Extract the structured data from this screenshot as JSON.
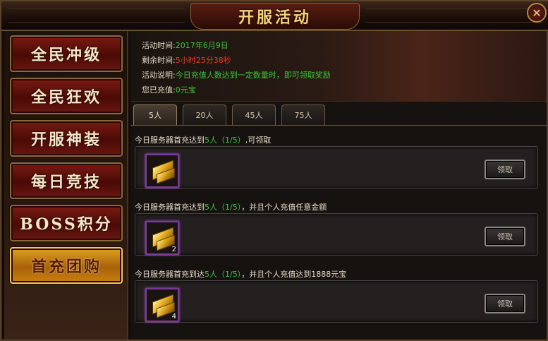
{
  "window": {
    "title": "开服活动",
    "close_glyph": "✕"
  },
  "sidebar": {
    "items": [
      {
        "label": "全民冲级",
        "active": false
      },
      {
        "label": "全民狂欢",
        "active": false
      },
      {
        "label": "开服神装",
        "active": false
      },
      {
        "label": "每日竞技",
        "active": false
      },
      {
        "label": "BOSS积分",
        "active": false
      },
      {
        "label": "首充团购",
        "active": true
      }
    ]
  },
  "info": {
    "time_label": "活动时间:",
    "time_value": "2017年6月9日",
    "remaining_label": "剩余时间:",
    "remaining_value": "5小时25分38秒",
    "desc_label": "活动说明:",
    "desc_value": "今日充值人数达到一定数量时，即可领取奖励",
    "recharged_label": "您已充值:",
    "recharged_value": "0元宝"
  },
  "tabs": [
    {
      "label": "5人",
      "active": true
    },
    {
      "label": "20人",
      "active": false
    },
    {
      "label": "45人",
      "active": false
    },
    {
      "label": "75人",
      "active": false
    }
  ],
  "rewards": [
    {
      "prefix": "今日服务器首充达到",
      "highlight": "5人（1/5）",
      "suffix": ",可领取",
      "item_count": "",
      "button": "领取"
    },
    {
      "prefix": "今日服务器首充达到",
      "highlight": "5人（1/5）",
      "suffix": "，并且个人充值任意金额",
      "item_count": "2",
      "button": "领取"
    },
    {
      "prefix": "今日服务器首充到达",
      "highlight": "5人（1/5）",
      "suffix": "，并且个人充值达到1888元宝",
      "item_count": "4",
      "button": "领取"
    }
  ],
  "colors": {
    "highlight_green": "#3ec43e",
    "highlight_red": "#e83a28",
    "title_gold": "#f4d27a",
    "active_nav": "#c88010"
  }
}
